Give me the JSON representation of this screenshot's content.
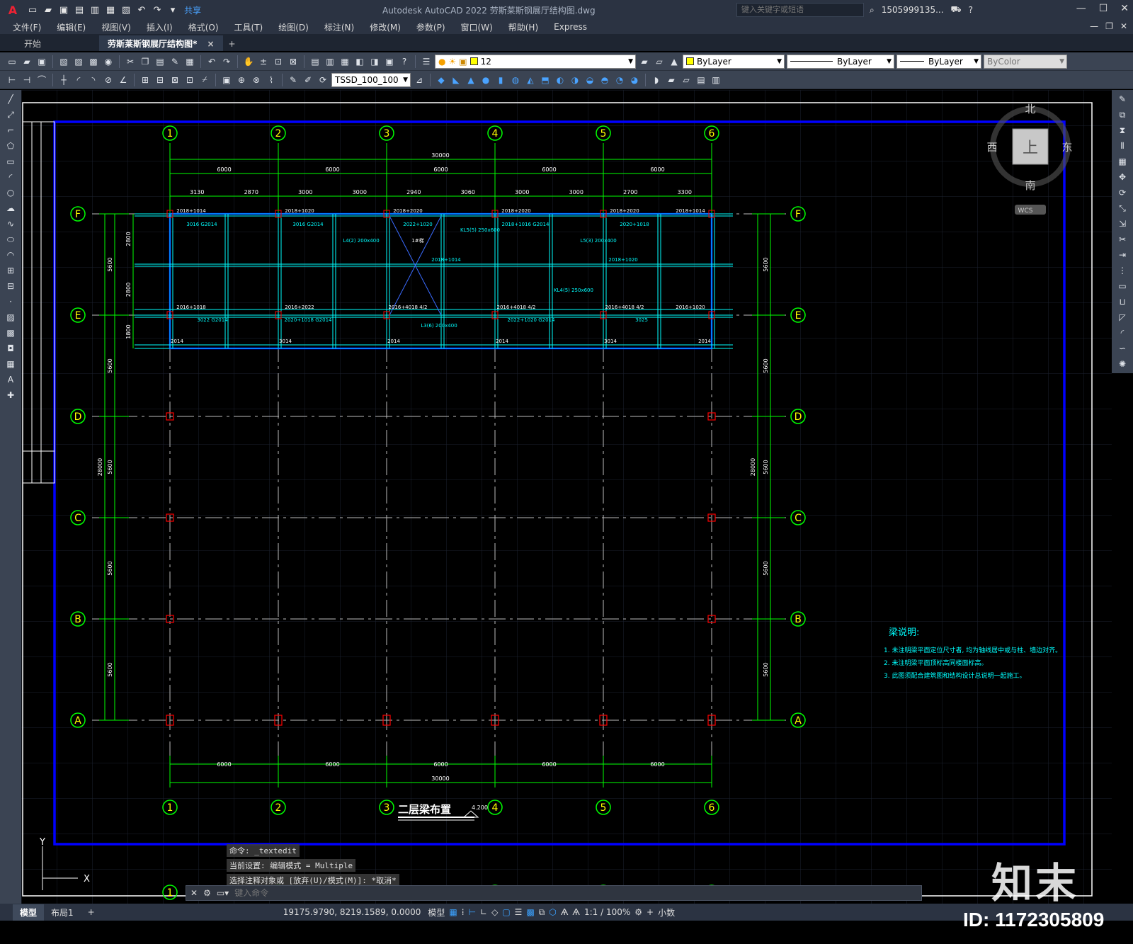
{
  "app": {
    "title": "Autodesk AutoCAD 2022    劳斯莱斯钢展厅结构图.dwg",
    "share_label": "共享",
    "search_placeholder": "键入关键字或短语",
    "user": "1505999135...",
    "logo": "A"
  },
  "menu": {
    "items": [
      "文件(F)",
      "编辑(E)",
      "视图(V)",
      "插入(I)",
      "格式(O)",
      "工具(T)",
      "绘图(D)",
      "标注(N)",
      "修改(M)",
      "参数(P)",
      "窗口(W)",
      "帮助(H)",
      "Express"
    ]
  },
  "tabs": {
    "start": "开始",
    "active": "劳斯莱斯钢展厅结构图*",
    "close": "×",
    "add": "+"
  },
  "toolbar": {
    "layer_value": "12",
    "text_style": "TSSD_100_100",
    "color": "ByLayer",
    "linetype": "ByLayer",
    "lineweight": "ByLayer",
    "plotstyle": "ByColor"
  },
  "viewcube": {
    "north": "北",
    "south": "南",
    "east": "东",
    "west": "西",
    "top": "上",
    "wcs": "WCS"
  },
  "drawing": {
    "title": "二层梁布置",
    "elevation": "4.200",
    "column_axes": [
      "1",
      "2",
      "3",
      "4",
      "5",
      "6"
    ],
    "row_axes": [
      "F",
      "E",
      "D",
      "C",
      "B",
      "A"
    ],
    "top_total": "30000",
    "top_spans": [
      "6000",
      "6000",
      "6000",
      "6000",
      "6000"
    ],
    "top_subspans": [
      "3130",
      "2870",
      "3000",
      "3000",
      "2940",
      "3060",
      "3000",
      "3000",
      "2700",
      "3300"
    ],
    "bottom_spans": [
      "6000",
      "6000",
      "6000",
      "6000",
      "6000"
    ],
    "bottom_total": "30000",
    "side_spans": [
      "5600",
      "5600",
      "5600",
      "5600",
      "5600"
    ],
    "side_sub": [
      "2800",
      "2800",
      "1800"
    ],
    "side_total": "28000",
    "beam_labels_top": [
      "2018+1014",
      "2018+1020",
      "2018+2020",
      "2018+2020",
      "2018+2020",
      "2018+1014"
    ],
    "beam_labels_mid": [
      "2016+1018",
      "2016+2022",
      "2016+4018 4/2",
      "2016+4018 4/2",
      "2016+4018 4/2",
      "2016+1020"
    ],
    "beam_labels_bot": [
      "2014",
      "3014",
      "2014",
      "2014",
      "3014",
      "2014"
    ],
    "beam_tags": [
      "3016 G2014",
      "3016 G2014",
      "2022+1020",
      "2018+1016 G2014",
      "2020+1018",
      "1#梯",
      "KL5(5) 250x600",
      "L4(2) 200x400",
      "L5(3) 200x400",
      "L3(6) 200x400",
      "KL4(5) 250x600",
      "2020+1018 G2014",
      "2022+1020 G2014",
      "3022 G2014",
      "3025",
      "2018+1020",
      "2018+1014"
    ],
    "notes_title": "梁说明:",
    "notes": [
      "1. 未注明梁平面定位尺寸者, 均为轴线居中或与柱、墙边对齐。",
      "2. 未注明梁平面顶标高同楼面标高。",
      "3. 此图须配合建筑图和结构设计总说明一起施工。"
    ],
    "ucs_y": "Y",
    "ucs_x": "X"
  },
  "command": {
    "history": [
      "命令: _textedit",
      "当前设置: 编辑模式 = Multiple",
      "选择注释对象或 [放弃(U)/模式(M)]: *取消*"
    ],
    "placeholder": "键入命令"
  },
  "status": {
    "layout_tabs": [
      "模型",
      "布局1"
    ],
    "add_tab": "+",
    "coords": "19175.9790, 8219.1589, 0.0000",
    "model": "模型",
    "scale": "1:1 / 100%",
    "units": "小数"
  },
  "watermark": {
    "brand": "知末",
    "id": "ID: 1172305809"
  },
  "colors": {
    "grid_green": "#00ff00",
    "axis_bubble": "#ffff00",
    "border_blue": "#0000ff",
    "beam_cyan": "#00ffff",
    "column_red": "#ff0000",
    "notes_cyan": "#00ffff"
  }
}
